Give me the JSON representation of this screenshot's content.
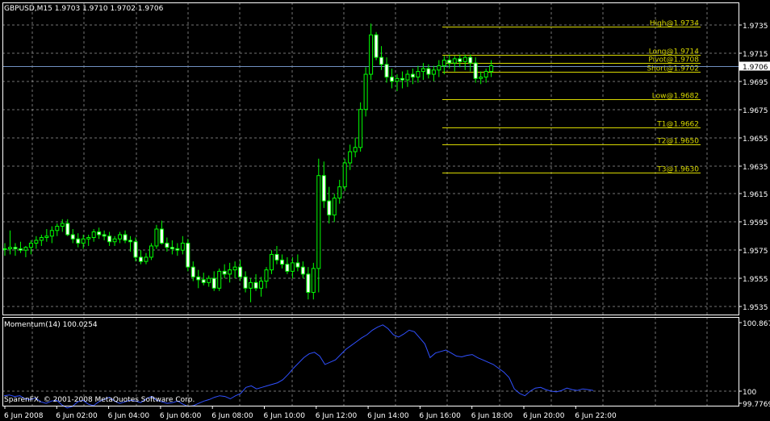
{
  "window": {
    "symbol_header": "GBPUSD,M15  1.9703 1.9710 1.9702 1.9706"
  },
  "colors": {
    "background": "#000000",
    "grid": "#C0C0C0",
    "bull_candle": "#00FF00",
    "bear_candle": "#FFFFFF",
    "level_lines": "#D8D800",
    "current_price_line": "#7090C0",
    "momentum_line": "#3050FF",
    "axis_text": "#FFFFFF"
  },
  "price_axis": {
    "ticks": [
      "1.9735",
      "1.9715",
      "1.9695",
      "1.9675",
      "1.9655",
      "1.9635",
      "1.9615",
      "1.9595",
      "1.9575",
      "1.9555",
      "1.9535"
    ],
    "current_price_tag": "1.9706"
  },
  "time_axis": {
    "ticks": [
      "6 Jun 2008",
      "6 Jun 02:00",
      "6 Jun 04:00",
      "6 Jun 06:00",
      "6 Jun 08:00",
      "6 Jun 10:00",
      "6 Jun 12:00",
      "6 Jun 14:00",
      "6 Jun 16:00",
      "6 Jun 18:00",
      "6 Jun 20:00",
      "6 Jun 22:00"
    ]
  },
  "levels": [
    {
      "label": "High@1.9734",
      "value": 1.9734
    },
    {
      "label": "Long@1.9714",
      "value": 1.9714
    },
    {
      "label": "Pivot@1.9708",
      "value": 1.9708
    },
    {
      "label": "Short@1.9702",
      "value": 1.9702
    },
    {
      "label": "Low@1.9682",
      "value": 1.9682
    },
    {
      "label": "T1@1.9662",
      "value": 1.9662
    },
    {
      "label": "T2@1.9650",
      "value": 1.965
    },
    {
      "label": "T3@1.9630",
      "value": 1.963
    }
  ],
  "indicator": {
    "title": "Momentum(14) 100.0254",
    "axis_ticks": [
      "100.8674",
      "100",
      "99.7769"
    ]
  },
  "footer": {
    "copyright": "SparenFX, © 2001-2008 MetaQuotes Software Corp."
  },
  "chart_data": [
    {
      "type": "candlestick",
      "title": "GBPUSD,M15",
      "ylim": [
        1.9525,
        1.9745
      ],
      "current_price": 1.9706,
      "candles": [
        [
          1.9576,
          1.958,
          1.9571,
          1.9576
        ],
        [
          1.9576,
          1.9589,
          1.9572,
          1.9577
        ],
        [
          1.9577,
          1.958,
          1.9571,
          1.9576
        ],
        [
          1.9576,
          1.9581,
          1.9573,
          1.9575
        ],
        [
          1.9575,
          1.9578,
          1.957,
          1.9577
        ],
        [
          1.9577,
          1.9582,
          1.9572,
          1.958
        ],
        [
          1.958,
          1.9585,
          1.9576,
          1.9582
        ],
        [
          1.9582,
          1.9586,
          1.9578,
          1.9584
        ],
        [
          1.9584,
          1.959,
          1.9581,
          1.9585
        ],
        [
          1.9585,
          1.9592,
          1.958,
          1.9589
        ],
        [
          1.9589,
          1.9594,
          1.9585,
          1.9592
        ],
        [
          1.9592,
          1.9597,
          1.9588,
          1.9594
        ],
        [
          1.9594,
          1.9597,
          1.9585,
          1.9586
        ],
        [
          1.9586,
          1.959,
          1.958,
          1.9583
        ],
        [
          1.9583,
          1.9587,
          1.9577,
          1.958
        ],
        [
          1.958,
          1.9586,
          1.9576,
          1.9583
        ],
        [
          1.9583,
          1.9586,
          1.9578,
          1.9584
        ],
        [
          1.9584,
          1.959,
          1.9581,
          1.9588
        ],
        [
          1.9588,
          1.9591,
          1.9583,
          1.9586
        ],
        [
          1.9586,
          1.9589,
          1.9582,
          1.9585
        ],
        [
          1.9585,
          1.9588,
          1.9578,
          1.9581
        ],
        [
          1.9581,
          1.9585,
          1.9578,
          1.9583
        ],
        [
          1.9583,
          1.9588,
          1.958,
          1.9586
        ],
        [
          1.9586,
          1.9589,
          1.958,
          1.9582
        ],
        [
          1.9582,
          1.9585,
          1.9574,
          1.9581
        ],
        [
          1.9581,
          1.9584,
          1.9567,
          1.957
        ],
        [
          1.957,
          1.9575,
          1.9565,
          1.9567
        ],
        [
          1.9567,
          1.9573,
          1.9565,
          1.957
        ],
        [
          1.957,
          1.958,
          1.9568,
          1.9578
        ],
        [
          1.9578,
          1.9593,
          1.9576,
          1.959
        ],
        [
          1.959,
          1.9596,
          1.9579,
          1.958
        ],
        [
          1.958,
          1.9584,
          1.9574,
          1.9577
        ],
        [
          1.9577,
          1.9582,
          1.9572,
          1.9576
        ],
        [
          1.9576,
          1.958,
          1.9571,
          1.9575
        ],
        [
          1.9575,
          1.9585,
          1.9572,
          1.958
        ],
        [
          1.958,
          1.9583,
          1.956,
          1.9563
        ],
        [
          1.9563,
          1.9567,
          1.9553,
          1.9556
        ],
        [
          1.9556,
          1.9561,
          1.9548,
          1.9554
        ],
        [
          1.9554,
          1.9559,
          1.955,
          1.9552
        ],
        [
          1.9552,
          1.9557,
          1.9549,
          1.9555
        ],
        [
          1.9555,
          1.956,
          1.9546,
          1.9548
        ],
        [
          1.9548,
          1.9562,
          1.9546,
          1.956
        ],
        [
          1.956,
          1.9565,
          1.9555,
          1.9558
        ],
        [
          1.9558,
          1.9566,
          1.9552,
          1.9561
        ],
        [
          1.9561,
          1.9567,
          1.9555,
          1.9563
        ],
        [
          1.9563,
          1.9568,
          1.9553,
          1.9556
        ],
        [
          1.9556,
          1.956,
          1.9545,
          1.9548
        ],
        [
          1.9548,
          1.9555,
          1.9538,
          1.9552
        ],
        [
          1.9552,
          1.9558,
          1.9546,
          1.9548
        ],
        [
          1.9548,
          1.9556,
          1.9542,
          1.9553
        ],
        [
          1.9553,
          1.9563,
          1.9548,
          1.9561
        ],
        [
          1.9561,
          1.9575,
          1.9558,
          1.9572
        ],
        [
          1.9572,
          1.9578,
          1.9565,
          1.9568
        ],
        [
          1.9568,
          1.9572,
          1.9562,
          1.9565
        ],
        [
          1.9565,
          1.957,
          1.9558,
          1.956
        ],
        [
          1.956,
          1.957,
          1.9555,
          1.9566
        ],
        [
          1.9566,
          1.9572,
          1.956,
          1.9563
        ],
        [
          1.9563,
          1.9567,
          1.9555,
          1.9558
        ],
        [
          1.9558,
          1.9563,
          1.954,
          1.9545
        ],
        [
          1.9545,
          1.9566,
          1.954,
          1.9562
        ],
        [
          1.9562,
          1.964,
          1.9545,
          1.9628
        ],
        [
          1.9628,
          1.9638,
          1.9605,
          1.961
        ],
        [
          1.961,
          1.962,
          1.9594,
          1.96
        ],
        [
          1.96,
          1.9615,
          1.9595,
          1.9612
        ],
        [
          1.9612,
          1.9625,
          1.9608,
          1.962
        ],
        [
          1.962,
          1.964,
          1.9617,
          1.9637
        ],
        [
          1.9637,
          1.965,
          1.9632,
          1.9645
        ],
        [
          1.9645,
          1.9655,
          1.9641,
          1.9648
        ],
        [
          1.9648,
          1.968,
          1.9645,
          1.9675
        ],
        [
          1.9675,
          1.9705,
          1.967,
          1.97
        ],
        [
          1.97,
          1.9736,
          1.9696,
          1.9728
        ],
        [
          1.9728,
          1.973,
          1.971,
          1.9712
        ],
        [
          1.9712,
          1.972,
          1.9703,
          1.9707
        ],
        [
          1.9707,
          1.9712,
          1.9694,
          1.9698
        ],
        [
          1.9698,
          1.9704,
          1.969,
          1.9695
        ],
        [
          1.9695,
          1.97,
          1.9688,
          1.9697
        ],
        [
          1.9697,
          1.9702,
          1.969,
          1.9696
        ],
        [
          1.9696,
          1.9703,
          1.9691,
          1.97
        ],
        [
          1.97,
          1.9704,
          1.9693,
          1.9698
        ],
        [
          1.9698,
          1.9706,
          1.9694,
          1.9702
        ],
        [
          1.9702,
          1.9708,
          1.9696,
          1.9704
        ],
        [
          1.9704,
          1.9707,
          1.9697,
          1.97
        ],
        [
          1.97,
          1.9706,
          1.9695,
          1.9703
        ],
        [
          1.9703,
          1.971,
          1.9698,
          1.9706
        ],
        [
          1.9706,
          1.9713,
          1.97,
          1.971
        ],
        [
          1.971,
          1.9714,
          1.9704,
          1.9708
        ],
        [
          1.9708,
          1.9713,
          1.9702,
          1.9711
        ],
        [
          1.9711,
          1.9714,
          1.9705,
          1.9709
        ],
        [
          1.9709,
          1.9714,
          1.9703,
          1.9712
        ],
        [
          1.9712,
          1.9714,
          1.9702,
          1.9708
        ],
        [
          1.9708,
          1.9712,
          1.9694,
          1.9697
        ],
        [
          1.9697,
          1.9702,
          1.9693,
          1.9698
        ],
        [
          1.9698,
          1.9704,
          1.9694,
          1.9702
        ],
        [
          1.9702,
          1.971,
          1.9698,
          1.9706
        ]
      ]
    },
    {
      "type": "line",
      "title": "Momentum(14) 100.0254",
      "ylim": [
        99.7769,
        100.8674
      ],
      "series": [
        {
          "name": "Momentum(14)",
          "values": [
            99.94,
            99.95,
            99.93,
            99.94,
            99.9,
            99.89,
            99.91,
            99.86,
            99.84,
            99.87,
            99.88,
            99.82,
            99.78,
            99.8,
            99.86,
            99.88,
            99.83,
            99.81,
            99.86,
            99.89,
            99.92,
            99.87,
            99.84,
            99.86,
            99.88,
            99.87,
            99.85,
            99.9,
            99.93,
            99.88,
            99.86,
            99.84,
            99.85,
            99.87,
            99.83,
            99.8,
            99.81,
            99.84,
            99.87,
            99.89,
            99.92,
            99.94,
            99.93,
            99.9,
            99.94,
            99.97,
            100.05,
            100.07,
            100.03,
            100.05,
            100.07,
            100.09,
            100.11,
            100.15,
            100.22,
            100.3,
            100.37,
            100.44,
            100.49,
            100.51,
            100.46,
            100.35,
            100.38,
            100.41,
            100.48,
            100.55,
            100.6,
            100.65,
            100.7,
            100.74,
            100.8,
            100.84,
            100.87,
            100.82,
            100.74,
            100.71,
            100.75,
            100.8,
            100.78,
            100.7,
            100.62,
            100.44,
            100.5,
            100.52,
            100.54,
            100.5,
            100.46,
            100.45,
            100.47,
            100.48,
            100.44,
            100.41,
            100.38,
            100.35,
            100.3,
            100.25,
            100.18,
            100.03,
            99.97,
            99.94,
            100.0,
            100.04,
            100.05,
            100.02,
            100.0,
            99.99,
            100.01,
            100.04,
            100.02,
            100.01,
            100.03,
            100.02,
            100.01
          ]
        }
      ]
    }
  ]
}
